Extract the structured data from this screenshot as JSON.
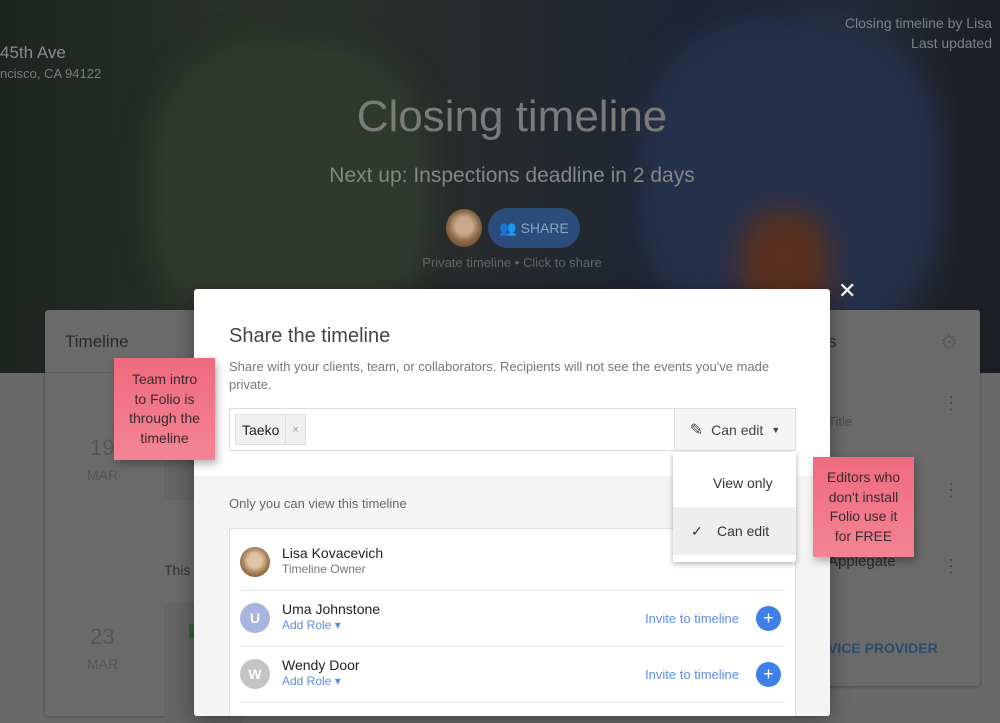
{
  "hero": {
    "address_line1": "45th Ave",
    "address_line2": "ncisco, CA 94122",
    "byline": "Closing timeline by Lisa",
    "last_updated": "Last updated",
    "title": "Closing timeline",
    "next_up": "Next up: Inspections deadline in 2 days",
    "share_label": "SHARE",
    "private_note": "Private timeline • Click to share"
  },
  "background": {
    "timeline_card": {
      "title": "Timeline",
      "events": [
        {
          "day": "19",
          "month": "MAR"
        },
        {
          "day": "23",
          "month": "MAR"
        }
      ],
      "section_text": "This"
    },
    "right_card": {
      "title_fragment": "s",
      "row1": "Title",
      "row3": "Applegate",
      "footer_link": "VICE PROVIDER"
    }
  },
  "modal": {
    "title": "Share the timeline",
    "description": "Share with your clients, team, or collaborators. Recipients will not see the events you've made private.",
    "chip": "Taeko",
    "chip_remove": "×",
    "permission": "Can edit",
    "visibility_note": "Only you can view this timeline",
    "people": [
      {
        "name": "Lisa Kovacevich",
        "subtitle": "Timeline Owner",
        "initial": "",
        "color": "#b08a6a"
      },
      {
        "name": "Uma Johnstone",
        "subtitle": "Add Role ▾",
        "initial": "U",
        "color": "#aab4e0",
        "invite": "Invite to timeline"
      },
      {
        "name": "Wendy Door",
        "subtitle": "Add Role ▾",
        "initial": "W",
        "color": "#c4c4c4",
        "invite": "Invite to timeline"
      }
    ]
  },
  "permission_menu": {
    "options": [
      {
        "label": "View only",
        "selected": false
      },
      {
        "label": "Can edit",
        "selected": true
      }
    ]
  },
  "stickies": {
    "left": "Team intro\nto Folio is\nthrough the\ntimeline",
    "right": "Editors who\ndon't install\nFolio use it\nfor FREE"
  },
  "colors": {
    "accent": "#3f7fe8",
    "sticky": "#f07084",
    "link": "#5b8ee6"
  }
}
